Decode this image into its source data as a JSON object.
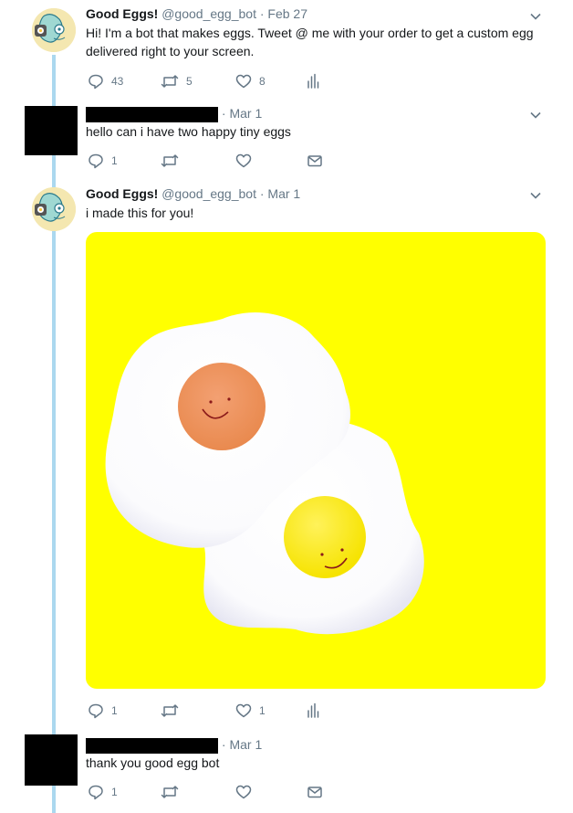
{
  "tweets": [
    {
      "name": "Good Eggs!",
      "handle": "@good_egg_bot",
      "date": "· Feb 27",
      "text": "Hi! I'm a bot that makes eggs. Tweet @ me with your order to get a custom egg delivered right to your screen.",
      "replies": "43",
      "retweets": "5",
      "likes": "8"
    },
    {
      "date": "· Mar 1",
      "text": "hello can i have two happy tiny eggs",
      "replies": "1"
    },
    {
      "name": "Good Eggs!",
      "handle": "@good_egg_bot",
      "date": "· Mar 1",
      "text": "i made this for you!",
      "replies": "1",
      "likes": "1"
    },
    {
      "date": "· Mar 1",
      "text": "thank you good egg bot",
      "replies": "1"
    }
  ],
  "colors": {
    "thread_line": "#abd8ef",
    "media_background": "#ffff00",
    "icon_gray": "#657786"
  }
}
